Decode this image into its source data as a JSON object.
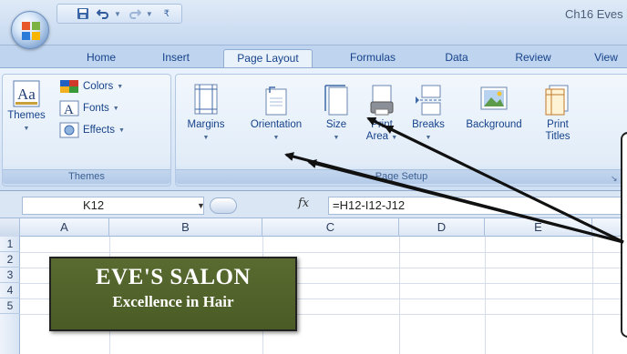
{
  "window": {
    "title": "Ch16 Eves"
  },
  "quick_access": {
    "items": [
      "save-icon",
      "undo-icon",
      "redo-icon",
      "customize-icon"
    ]
  },
  "tabs": [
    {
      "label": "Home",
      "active": false
    },
    {
      "label": "Insert",
      "active": false
    },
    {
      "label": "Page Layout",
      "active": true
    },
    {
      "label": "Formulas",
      "active": false
    },
    {
      "label": "Data",
      "active": false
    },
    {
      "label": "Review",
      "active": false
    },
    {
      "label": "View",
      "active": false
    }
  ],
  "ribbon": {
    "themes_group": {
      "label": "Themes",
      "themes_button": "Themes",
      "colors_button": "Colors",
      "fonts_button": "Fonts",
      "effects_button": "Effects"
    },
    "page_setup_group": {
      "label": "Page Setup",
      "margins": "Margins",
      "orientation": "Orientation",
      "size": "Size",
      "print_area_line1": "Print",
      "print_area_line2": "Area",
      "breaks": "Breaks",
      "background": "Background",
      "print_titles_line1": "Print",
      "print_titles_line2": "Titles"
    }
  },
  "formula_bar": {
    "name_box": "K12",
    "fx_label": "fx",
    "formula": "=H12-I12-J12"
  },
  "grid": {
    "columns": [
      "A",
      "B",
      "C",
      "D",
      "E"
    ],
    "rows": [
      "1",
      "2",
      "3",
      "4",
      "5"
    ]
  },
  "salon_label": {
    "title": "EVE'S SALON",
    "subtitle": "Excellence in Hair"
  },
  "colors": {
    "ribbon_text": "#15428b",
    "salon_background": "#4f6129",
    "tab_strip": "#bfd4ee"
  }
}
